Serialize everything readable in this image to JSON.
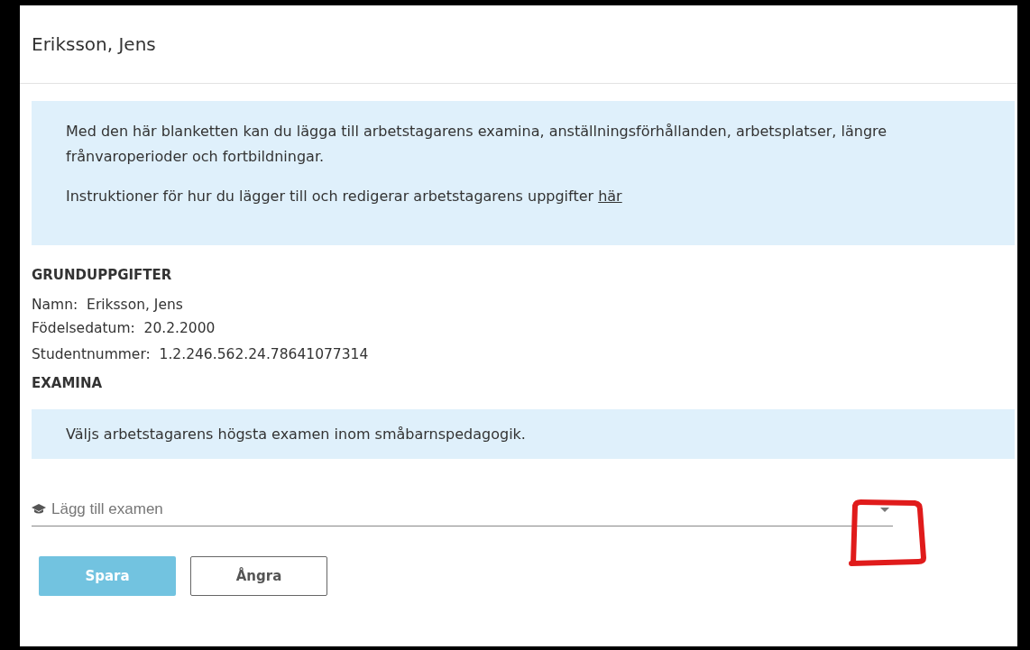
{
  "dialog": {
    "title": "Eriksson, Jens"
  },
  "intro": {
    "text": "Med den här blanketten kan du lägga till arbetstagarens examina, anställningsförhållanden, arbetsplatser, längre frånvaroperioder och fortbildningar.",
    "instructions": "Instruktioner för hur du lägger till och redigerar arbetstagarens uppgifter",
    "link": "här"
  },
  "basic_info": {
    "heading": "GRUNDUPPGIFTER",
    "rows": [
      {
        "label": "Namn:",
        "value": "Eriksson, Jens"
      },
      {
        "label": "Födelsedatum:",
        "value": "20.2.2000"
      },
      {
        "label": "Studentnummer:",
        "value": "1.2.246.562.24.78641077314"
      }
    ]
  },
  "degrees": {
    "heading": "EXAMINA",
    "note": "Väljs arbetstagarens högsta examen inom småbarnspedagogik.",
    "select": {
      "placeholder": "Lägg till examen"
    }
  },
  "buttons": [
    {
      "label": "Spara",
      "kind": "primary"
    },
    {
      "label": "Ångra",
      "kind": "secondary"
    }
  ]
}
